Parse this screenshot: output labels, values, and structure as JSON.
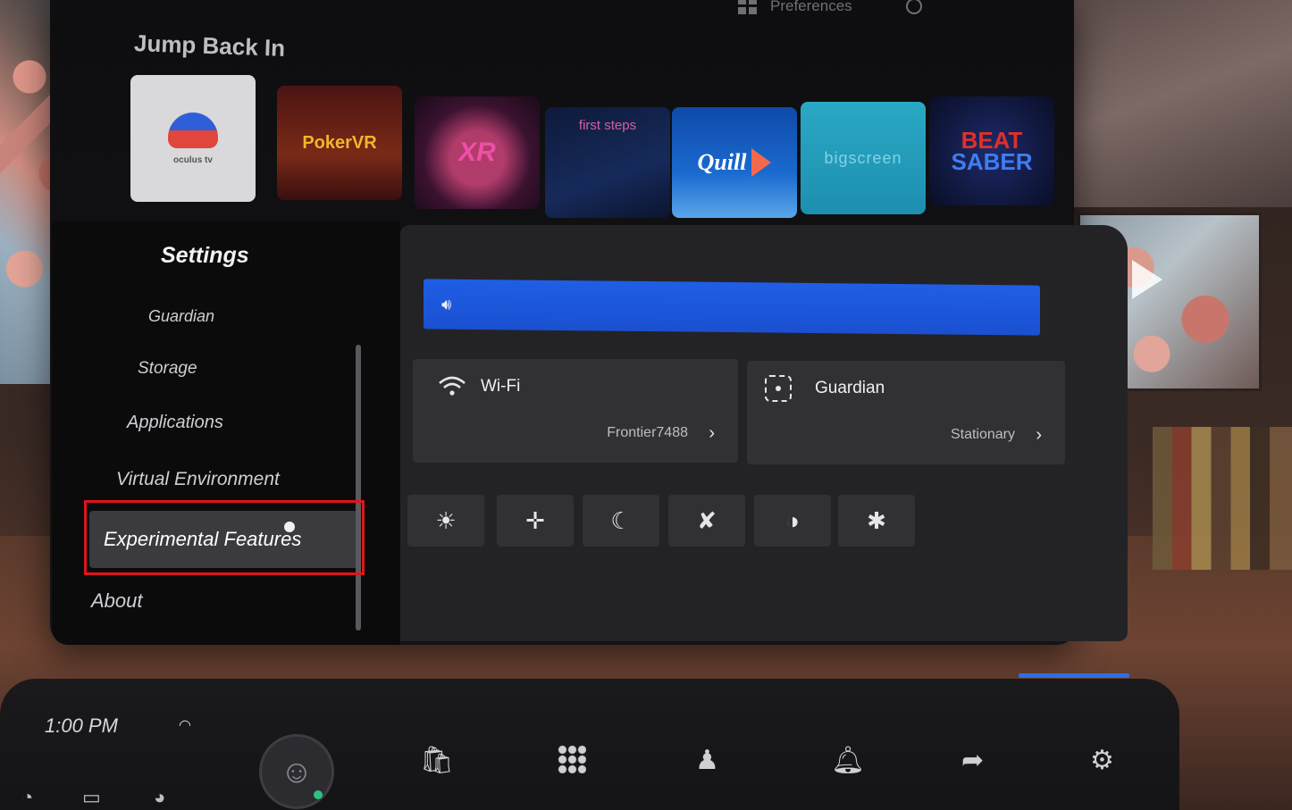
{
  "top_nav": {
    "preferences_label": "Preferences"
  },
  "library": {
    "section_title": "Jump Back In",
    "tiles": [
      {
        "name": "oculus-tv",
        "label": "oculus tv"
      },
      {
        "name": "pokervr",
        "label": "PokerVR"
      },
      {
        "name": "casino",
        "label": "XR"
      },
      {
        "name": "first-steps",
        "label": "first steps"
      },
      {
        "name": "quill-theater",
        "label": "Quill"
      },
      {
        "name": "bigscreen",
        "label": "bigscreen"
      },
      {
        "name": "beat-saber",
        "label_top": "BEAT",
        "label_bottom": "SABER"
      }
    ]
  },
  "settings": {
    "title": "Settings",
    "items": [
      "Guardian",
      "Storage",
      "Applications",
      "Virtual Environment",
      "Experimental Features",
      "About"
    ],
    "selected": "Experimental Features"
  },
  "quick_settings": {
    "volume_icon": "speaker-icon",
    "wifi": {
      "title": "Wi-Fi",
      "value": "Frontier7488"
    },
    "guardian": {
      "title": "Guardian",
      "value": "Stationary"
    },
    "buttons": [
      "brightness-icon",
      "recenter-icon",
      "night-mode-icon",
      "mic-mute-icon",
      "passthrough-icon",
      "bug-report-icon"
    ]
  },
  "system_bar": {
    "time": "1:00 PM",
    "icons": [
      "store-icon",
      "apps-icon",
      "people-icon",
      "notifications-icon",
      "share-icon",
      "settings-icon"
    ]
  },
  "colors": {
    "accent_blue": "#1f5ee6",
    "highlight_red": "#e0151a",
    "panel_dark": "#0b0b0c",
    "card_gray": "#313135"
  }
}
